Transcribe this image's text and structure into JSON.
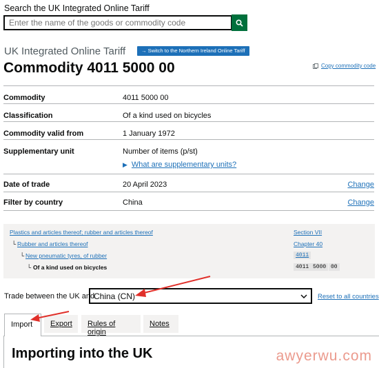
{
  "search": {
    "label": "Search the UK Integrated Online Tariff",
    "placeholder": "Enter the name of the goods or commodity code",
    "icon": "search-icon"
  },
  "header": {
    "caption": "UK Integrated Online Tariff",
    "switch_button": "→ Switch to the Northern Ireland Online Tariff",
    "title": "Commodity 4011 5000 00",
    "copy_link": "Copy commodity code"
  },
  "details": [
    {
      "key": "Commodity",
      "value": "4011 5000 00"
    },
    {
      "key": "Classification",
      "value": "Of a kind used on bicycles"
    },
    {
      "key": "Commodity valid from",
      "value": "1 January 1972"
    },
    {
      "key": "Supplementary unit",
      "value": "Number of items (p/st)",
      "link": "What are supplementary units?"
    },
    {
      "key": "Date of trade",
      "value": "20 April 2023",
      "action": "Change"
    },
    {
      "key": "Filter by country",
      "value": "China",
      "action": "Change"
    }
  ],
  "hierarchy": [
    {
      "label": "Plastics and articles thereof; rubber and articles thereof",
      "ref": "Section VII"
    },
    {
      "label": "Rubber and articles thereof",
      "ref": "Chapter 40"
    },
    {
      "label": "New pneumatic tyres, of rubber",
      "ref": "4011"
    },
    {
      "label": "Of a kind used on bicycles",
      "ref_parts": [
        "4011",
        "5000",
        "00"
      ]
    }
  ],
  "trade": {
    "label": "Trade between the UK and",
    "selected": "China (CN)",
    "reset": "Reset to all countries"
  },
  "tabs": [
    "Import",
    "Export",
    "Rules of origin",
    "Notes"
  ],
  "panel": {
    "title": "Importing into the UK"
  },
  "watermark": "awyerwu.com",
  "colors": {
    "link": "#1d70b8",
    "button_green": "#00703c",
    "annotation_red": "#e0302a"
  }
}
